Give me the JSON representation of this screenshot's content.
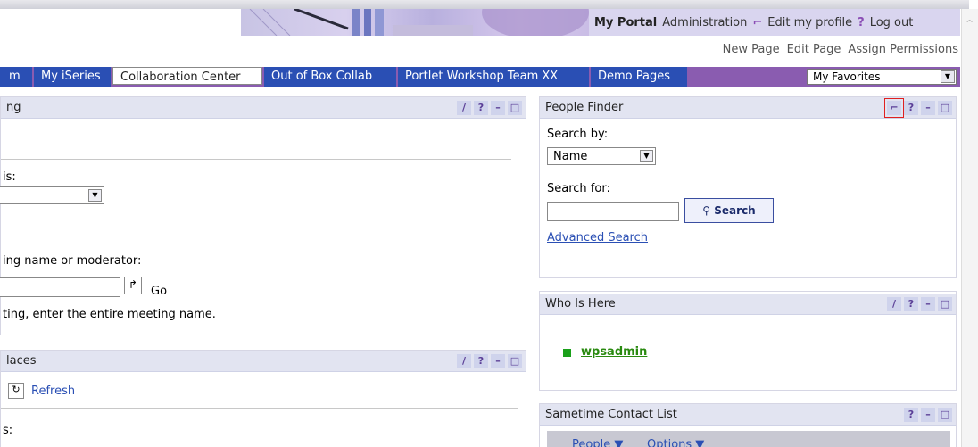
{
  "header": {
    "nav": {
      "current": "My Portal",
      "administration": "Administration",
      "edit_profile": "Edit my profile",
      "logout": "Log out"
    },
    "page_links": {
      "new_page": "New Page",
      "edit_page": "Edit Page",
      "assign_permissions": "Assign Permissions"
    }
  },
  "tabs": [
    {
      "label": "m"
    },
    {
      "label": "My iSeries"
    },
    {
      "label": "Collaboration Center"
    },
    {
      "label": "Out of Box Collab"
    },
    {
      "label": "Portlet Workshop Team XX"
    },
    {
      "label": "Demo Pages"
    }
  ],
  "favorites": {
    "selected": "My Favorites"
  },
  "left_top": {
    "title": "ng",
    "label_is": "is:",
    "label_name": "ing name or moderator:",
    "go": "Go",
    "hint": "ting, enter the entire meeting name."
  },
  "left_bottom": {
    "title": "laces",
    "refresh": "Refresh",
    "label_s": "s:"
  },
  "people_finder": {
    "title": "People Finder",
    "search_by": "Search by:",
    "search_by_value": "Name",
    "search_for": "Search for:",
    "search_button": "Search",
    "advanced": "Advanced Search"
  },
  "who_is_here": {
    "title": "Who Is Here",
    "user": "wpsadmin"
  },
  "contact_list": {
    "title": "Sametime Contact List",
    "people": "People",
    "options": "Options"
  }
}
